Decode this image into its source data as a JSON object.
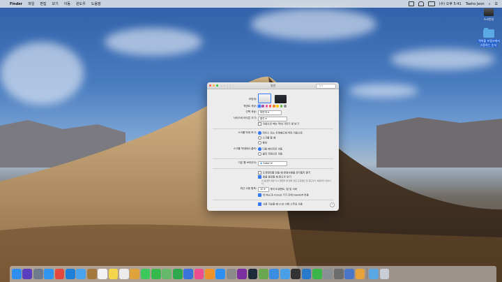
{
  "menubar": {
    "apple": "",
    "app_name": "Finder",
    "menus": [
      "파일",
      "편집",
      "보기",
      "이동",
      "윈도우",
      "도움말"
    ],
    "clock": "(수) 오후 5:41",
    "user": "Taeho Jeon"
  },
  "desktop_icons": [
    {
      "label": "스크린샷"
    },
    {
      "label": "맥북을 프랭크에서 사용하는 순서"
    }
  ],
  "window": {
    "title": "일반",
    "search_placeholder": "검색",
    "appearance": {
      "label": "모양새:"
    },
    "accent": {
      "label": "액센트 색상:",
      "colors": [
        "#3478f6",
        "#a550a7",
        "#f74f9e",
        "#ff5257",
        "#f7821b",
        "#ffc600",
        "#62ba46",
        "#8c8c8c"
      ]
    },
    "highlight": {
      "label": "선택 색상:",
      "value": "파란색"
    },
    "sidebar_icon": {
      "label": "사이드바 아이콘 크기:",
      "value": "중간"
    },
    "auto_hide": {
      "label": "자동으로 메뉴 막대 가리기 및 보기"
    },
    "scrollbars": {
      "label": "스크롤 막대 보기:",
      "options": [
        "마우스 또는 트랙패드에 따라 자동으로",
        "스크롤 할 때",
        "항상"
      ]
    },
    "click_scroll": {
      "label": "스크롤 막대에서 클릭:",
      "options": [
        "다음 페이지로 이동",
        "클릭 지점으로 이동"
      ]
    },
    "browser": {
      "label": "기본 웹 브라우저:",
      "value": "Safari"
    },
    "prefs": [
      "도큐멘트를 닫을 때 변경사항을 유지할지 묻기",
      "앱을 종료할 때 윈도우 닫기",
      "이 옵션을 켜면 다시 열었을 때 열려 있던 도큐멘트 및 윈도우가 복원되지 않습니다."
    ],
    "recent": {
      "label": "최근 사용 항목:",
      "value": "10",
      "suffix": "개의 도큐멘트, 앱 및 서버"
    },
    "handoff": "이 Mac과 iCloud 기기 간에 Handoff 허용",
    "lcd": "사용 가능할 때 LCD 서체 스무딩 사용",
    "help": "?"
  },
  "dock_apps": [
    {
      "name": "finder",
      "color": "#2f8ff0"
    },
    {
      "name": "siri",
      "color": "#5a3fbf"
    },
    {
      "name": "launchpad",
      "color": "#6e7b8c"
    },
    {
      "name": "safari",
      "color": "#2f95ee"
    },
    {
      "name": "chrome",
      "color": "#e4493f"
    },
    {
      "name": "safari-2",
      "color": "#1e7fd8"
    },
    {
      "name": "mail",
      "color": "#4aa3ee"
    },
    {
      "name": "notes-brown",
      "color": "#a5783d"
    },
    {
      "name": "calendar",
      "color": "#f2f2f2"
    },
    {
      "name": "notes",
      "color": "#f5d54a"
    },
    {
      "name": "reminders",
      "color": "#ececec"
    },
    {
      "name": "photos",
      "color": "#e0a33c"
    },
    {
      "name": "messages",
      "color": "#3ec95c"
    },
    {
      "name": "facetime",
      "color": "#35b94c"
    },
    {
      "name": "maps",
      "color": "#66b86a"
    },
    {
      "name": "numbers",
      "color": "#2ea84d"
    },
    {
      "name": "keynote",
      "color": "#3a73d9"
    },
    {
      "name": "itunes",
      "color": "#ee4d8f"
    },
    {
      "name": "books",
      "color": "#f0922c"
    },
    {
      "name": "app-store",
      "color": "#2f8ff0"
    },
    {
      "name": "system-preferences",
      "color": "#8a8a8a"
    },
    {
      "name": "onenote",
      "color": "#7b2fa0"
    },
    {
      "name": "lightroom",
      "color": "#1f2a3a"
    },
    {
      "name": "android-studio",
      "color": "#6aa84f"
    },
    {
      "name": "xcode",
      "color": "#3a8de0"
    },
    {
      "name": "folder",
      "color": "#4aa0e6"
    },
    {
      "name": "unity",
      "color": "#333333"
    },
    {
      "name": "vscode",
      "color": "#2a7acc"
    },
    {
      "name": "green-app",
      "color": "#3ab54a"
    },
    {
      "name": "utility",
      "color": "#8a8f96"
    },
    {
      "name": "tool",
      "color": "#6d6d6d"
    },
    {
      "name": "sync-app",
      "color": "#4a76c8"
    },
    {
      "name": "finance",
      "color": "#e7a23b"
    },
    {
      "name": "finder-folder",
      "color": "#5aa9e6"
    },
    {
      "name": "trash",
      "color": "#c9ced6"
    }
  ]
}
